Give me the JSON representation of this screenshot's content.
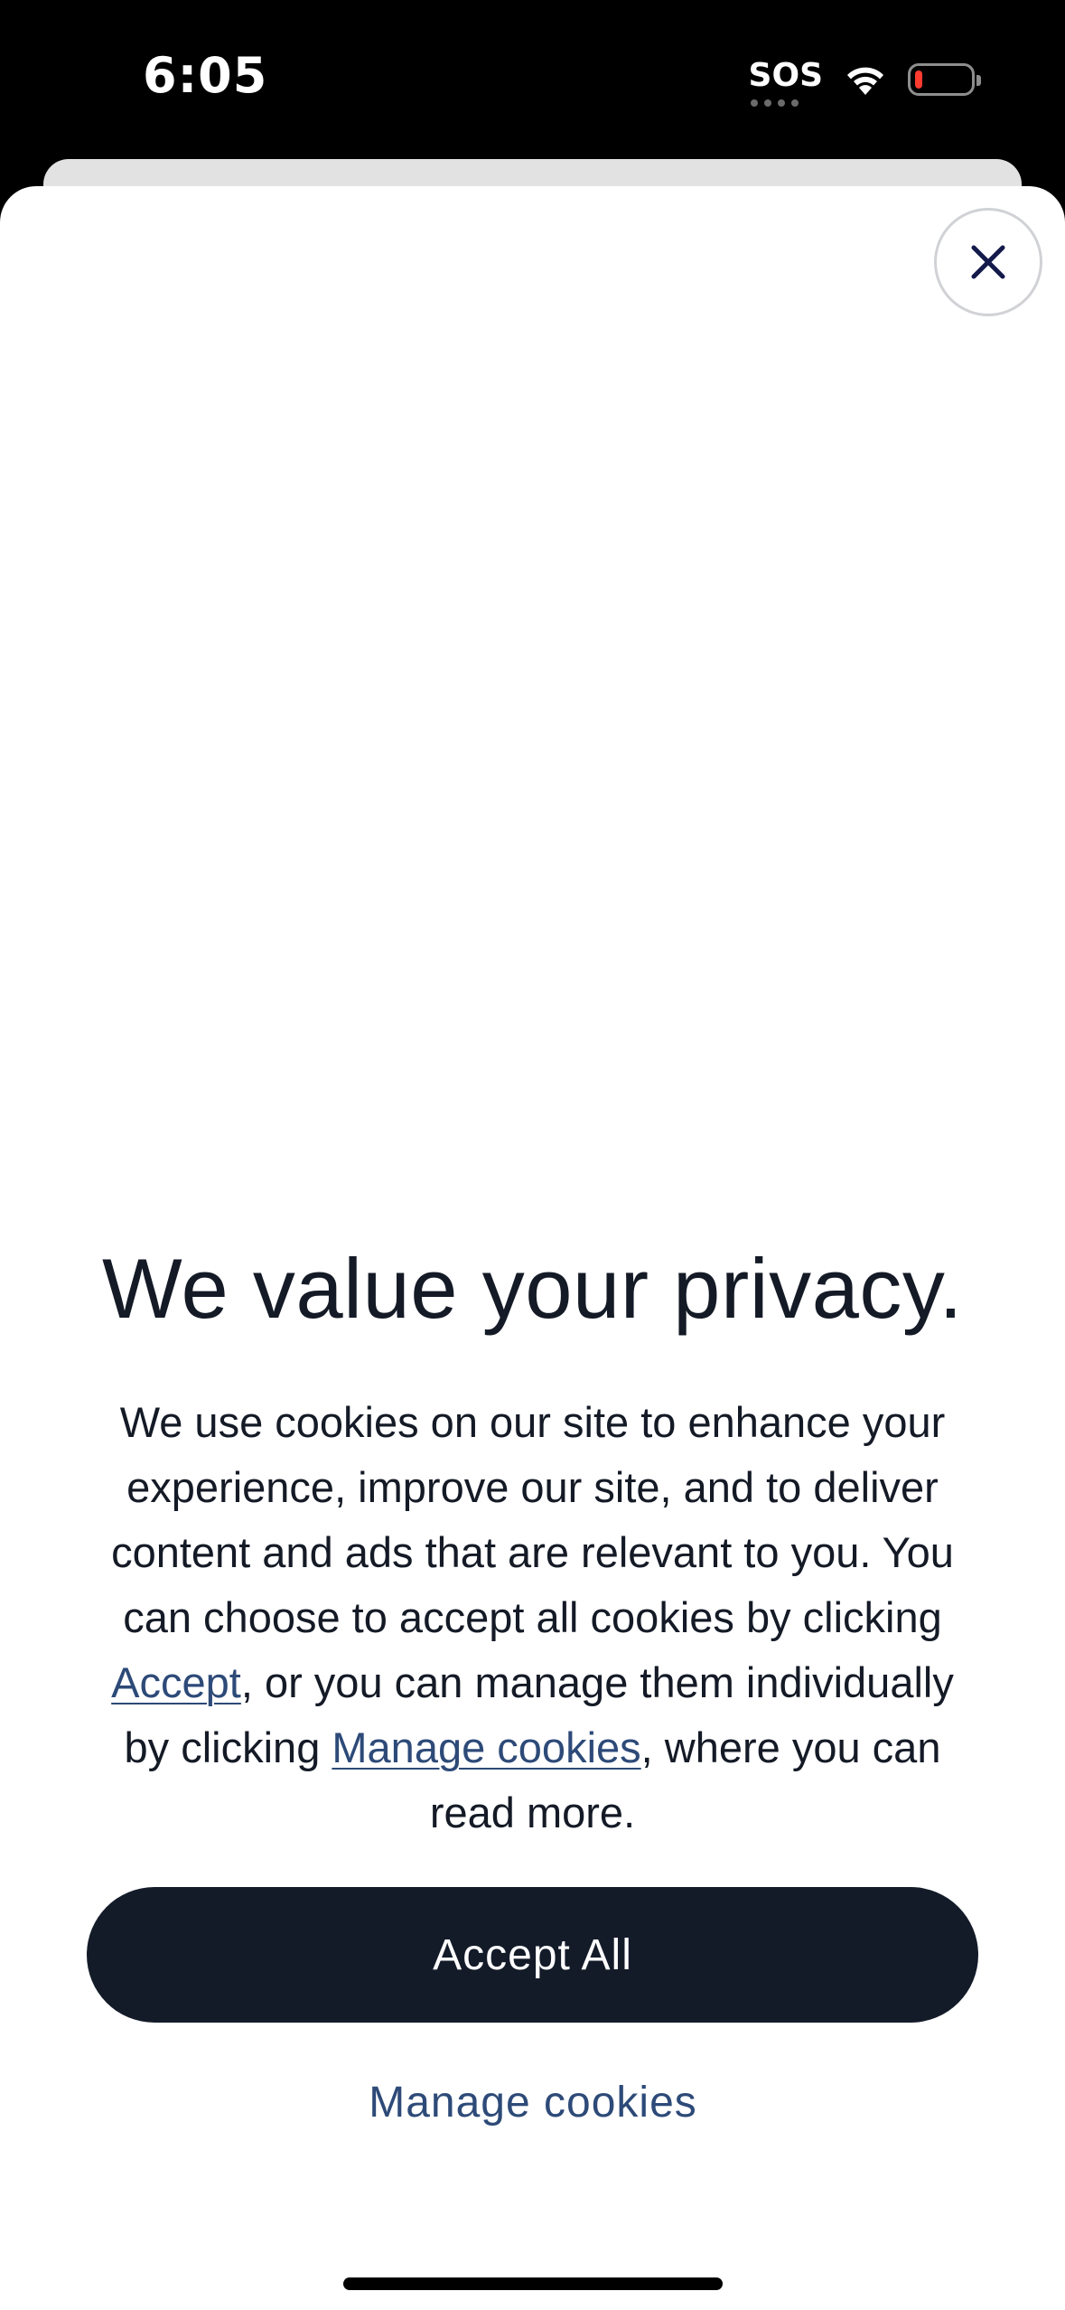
{
  "status_bar": {
    "time": "6:05",
    "sos_label": "SOS",
    "battery_level": 0.1
  },
  "modal": {
    "title": "We value your privacy.",
    "body": {
      "part1": "We use cookies on our site to enhance your experience, improve our site, and to deliver content and ads that are relevant to you. You can choose to accept all cookies by clicking ",
      "accept_link": "Accept",
      "part2": ", or you can manage them individually by clicking ",
      "manage_link": "Manage cookies",
      "part3": ", where you can read more."
    },
    "accept_all_label": "Accept All",
    "manage_cookies_label": "Manage cookies",
    "close_icon": "close-icon"
  },
  "colors": {
    "primary_dark": "#131b29",
    "link_blue": "#2d4a78",
    "battery_low": "#ff3b30"
  }
}
